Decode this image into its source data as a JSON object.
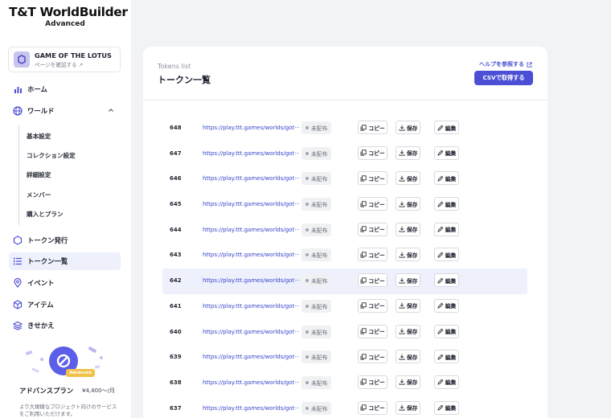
{
  "brand": {
    "logo": "T&T WorldBuilder",
    "edition": "Advanced"
  },
  "project": {
    "name": "GAME OF THE LOTUS",
    "link": "ページを確認する"
  },
  "nav": {
    "home": "ホーム",
    "world": "ワールド",
    "world_sub": [
      "基本設定",
      "コレクション設定",
      "詳細設定",
      "メンバー",
      "購入とプラン"
    ],
    "token_issue": "トークン発行",
    "token_list": "トークン一覧",
    "event": "イベント",
    "item": "アイテム",
    "dressup": "きせかえ"
  },
  "promo": {
    "tag": "Advanced",
    "title": "アドバンスプラン",
    "price": "¥4,400〜/月",
    "desc": "より大規模なプロジェクト向けのサービスをご利用いただけます。"
  },
  "panel": {
    "subtitle": "Tokens list",
    "title": "トークン一覧",
    "help": "ヘルプを参照する",
    "csv_button": "CSVで取得する"
  },
  "labels": {
    "copy": "コピー",
    "save": "保存",
    "edit": "編集"
  },
  "rows": [
    {
      "id": "648",
      "url": "https://play.ttt.games/worlds/got···",
      "status": "未配布"
    },
    {
      "id": "647",
      "url": "https://play.ttt.games/worlds/got···",
      "status": "未配布"
    },
    {
      "id": "646",
      "url": "https://play.ttt.games/worlds/got···",
      "status": "未配布"
    },
    {
      "id": "645",
      "url": "https://play.ttt.games/worlds/got···",
      "status": "未配布"
    },
    {
      "id": "644",
      "url": "https://play.ttt.games/worlds/got···",
      "status": "未配布"
    },
    {
      "id": "643",
      "url": "https://play.ttt.games/worlds/got···",
      "status": "未配布"
    },
    {
      "id": "642",
      "url": "https://play.ttt.games/worlds/got···",
      "status": "未配布"
    },
    {
      "id": "641",
      "url": "https://play.ttt.games/worlds/got···",
      "status": "未配布"
    },
    {
      "id": "640",
      "url": "https://play.ttt.games/worlds/got···",
      "status": "未配布"
    },
    {
      "id": "639",
      "url": "https://play.ttt.games/worlds/got···",
      "status": "未配布"
    },
    {
      "id": "638",
      "url": "https://play.ttt.games/worlds/got···",
      "status": "未配布"
    },
    {
      "id": "637",
      "url": "https://play.ttt.games/worlds/got···",
      "status": "未配布"
    }
  ],
  "colors": {
    "accent": "#4b4fd6",
    "link": "#3845c9",
    "highlight_row": "#eef0fc"
  }
}
